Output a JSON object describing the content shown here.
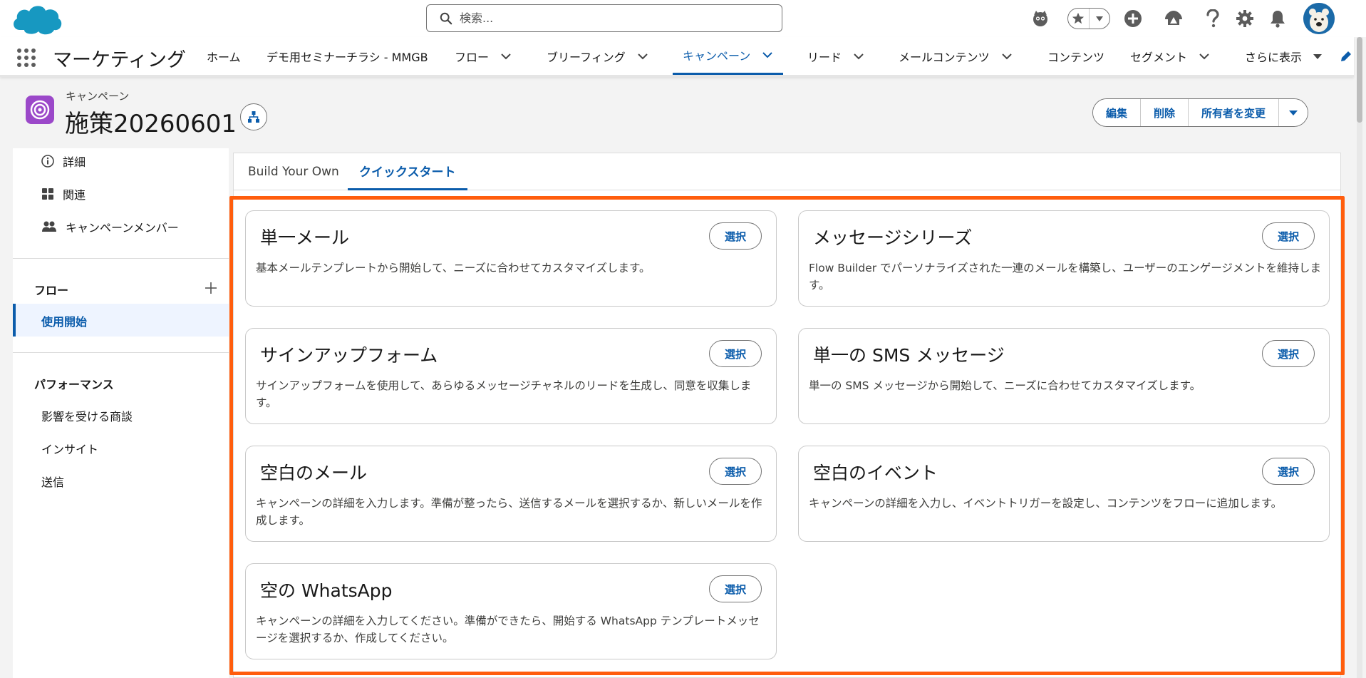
{
  "search": {
    "placeholder": "検索..."
  },
  "global_icons": [
    "einstein-icon",
    "favorites-star-icon",
    "favorites-menu-icon",
    "global-create-icon",
    "trailhead-icon",
    "help-icon",
    "setup-gear-icon",
    "notifications-bell-icon"
  ],
  "nav": {
    "app_name": "マーケティング",
    "items": [
      {
        "label": "ホーム",
        "has_menu": false
      },
      {
        "label": "デモ用セミナーチラシ - MMGB",
        "has_menu": false
      },
      {
        "label": "フロー",
        "has_menu": true
      },
      {
        "label": "ブリーフィング",
        "has_menu": true
      },
      {
        "label": "キャンペーン",
        "has_menu": true,
        "active": true
      },
      {
        "label": "リード",
        "has_menu": true
      },
      {
        "label": "メールコンテンツ",
        "has_menu": true
      },
      {
        "label": "コンテンツ",
        "has_menu": false
      },
      {
        "label": "セグメント",
        "has_menu": true
      },
      {
        "label": "さらに表示",
        "has_menu": true
      }
    ]
  },
  "record": {
    "object_label": "キャンペーン",
    "title": "施策20260601",
    "actions": [
      "編集",
      "削除",
      "所有者を変更"
    ]
  },
  "sidebar": {
    "items": [
      {
        "label": "詳細",
        "icon": "info-icon"
      },
      {
        "label": "関連",
        "icon": "related-icon"
      },
      {
        "label": "キャンペーンメンバー",
        "icon": "members-icon"
      }
    ],
    "flow_section": "フロー",
    "flow_active": "使用開始",
    "performance_section": "パフォーマンス",
    "performance_items": [
      "影響を受ける商談",
      "インサイト",
      "送信"
    ]
  },
  "tabs": [
    {
      "label": "Build Your Own",
      "active": false
    },
    {
      "label": "クイックスタート",
      "active": true
    }
  ],
  "cards": [
    {
      "title": "単一メール",
      "desc": "基本メールテンプレートから開始して、ニーズに合わせてカスタマイズします。",
      "button": "選択"
    },
    {
      "title": "メッセージシリーズ",
      "desc": "Flow Builder でパーソナライズされた一連のメールを構築し、ユーザーのエンゲージメントを維持します。",
      "button": "選択"
    },
    {
      "title": "サインアップフォーム",
      "desc": "サインアップフォームを使用して、あらゆるメッセージチャネルのリードを生成し、同意を収集します。",
      "button": "選択"
    },
    {
      "title": "単一の SMS メッセージ",
      "desc": "単一の SMS メッセージから開始して、ニーズに合わせてカスタマイズします。",
      "button": "選択"
    },
    {
      "title": "空白のメール",
      "desc": "キャンペーンの詳細を入力します。準備が整ったら、送信するメールを選択するか、新しいメールを作成します。",
      "button": "選択"
    },
    {
      "title": "空白のイベント",
      "desc": "キャンペーンの詳細を入力し、イベントトリガーを設定し、コンテンツをフローに追加します。",
      "button": "選択"
    },
    {
      "title": "空の WhatsApp",
      "desc": "キャンペーンの詳細を入力してください。準備ができたら、開始する WhatsApp テンプレートメッセージを選択するか、作成してください。",
      "button": "選択"
    }
  ],
  "colors": {
    "brand": "#0b5cab",
    "highlight": "#ff5d0d",
    "record_icon": "#9b48c9",
    "logo": "#1798c1"
  }
}
